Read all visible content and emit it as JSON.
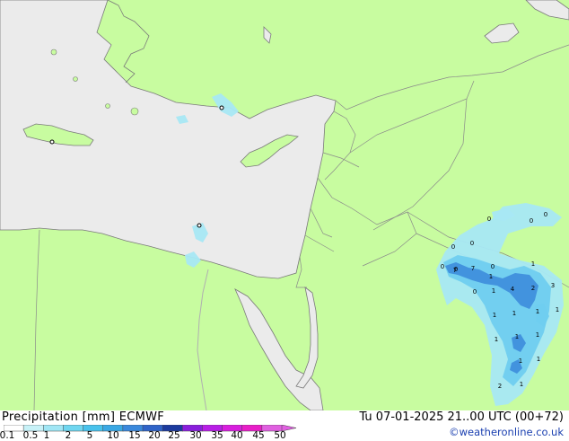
{
  "header": {
    "title": "Precipitation [mm]  ECMWF",
    "valid_time": "Tu 07-01-2025 21..00 UTC (00+72)",
    "credit": "©weatheronline.co.uk"
  },
  "legend": {
    "ticks": [
      "0.1",
      "0.5",
      "1",
      "2",
      "5",
      "10",
      "15",
      "20",
      "25",
      "30",
      "35",
      "40",
      "45",
      "50"
    ],
    "colors": [
      "#ffffff",
      "#c8f2f8",
      "#a0e6f5",
      "#6fd6f0",
      "#48c2ec",
      "#3aa8e4",
      "#3a88dc",
      "#2f63c8",
      "#1c3a9e",
      "#8a1edc",
      "#b81ee6",
      "#d81ede",
      "#e81ec8",
      "#e060e0"
    ]
  },
  "map": {
    "colors": {
      "land": "#c8fca0",
      "sea": "#ebebeb",
      "border": "#8a8a8a",
      "coast": "#7a7a7a"
    },
    "rain_labels": [
      {
        "text": "0"
      },
      {
        "text": "0"
      },
      {
        "text": "0"
      },
      {
        "text": "0"
      },
      {
        "text": "0"
      },
      {
        "text": "0"
      },
      {
        "text": "0"
      },
      {
        "text": "7"
      },
      {
        "text": "7"
      },
      {
        "text": "0"
      },
      {
        "text": "1"
      },
      {
        "text": "0"
      },
      {
        "text": "1"
      },
      {
        "text": "4"
      },
      {
        "text": "2"
      },
      {
        "text": "3"
      },
      {
        "text": "1"
      },
      {
        "text": "1"
      },
      {
        "text": "1"
      },
      {
        "text": "1"
      },
      {
        "text": "1"
      },
      {
        "text": "1"
      },
      {
        "text": "1"
      },
      {
        "text": "1"
      },
      {
        "text": "1"
      },
      {
        "text": "1"
      },
      {
        "text": "2"
      },
      {
        "text": "1"
      }
    ]
  }
}
